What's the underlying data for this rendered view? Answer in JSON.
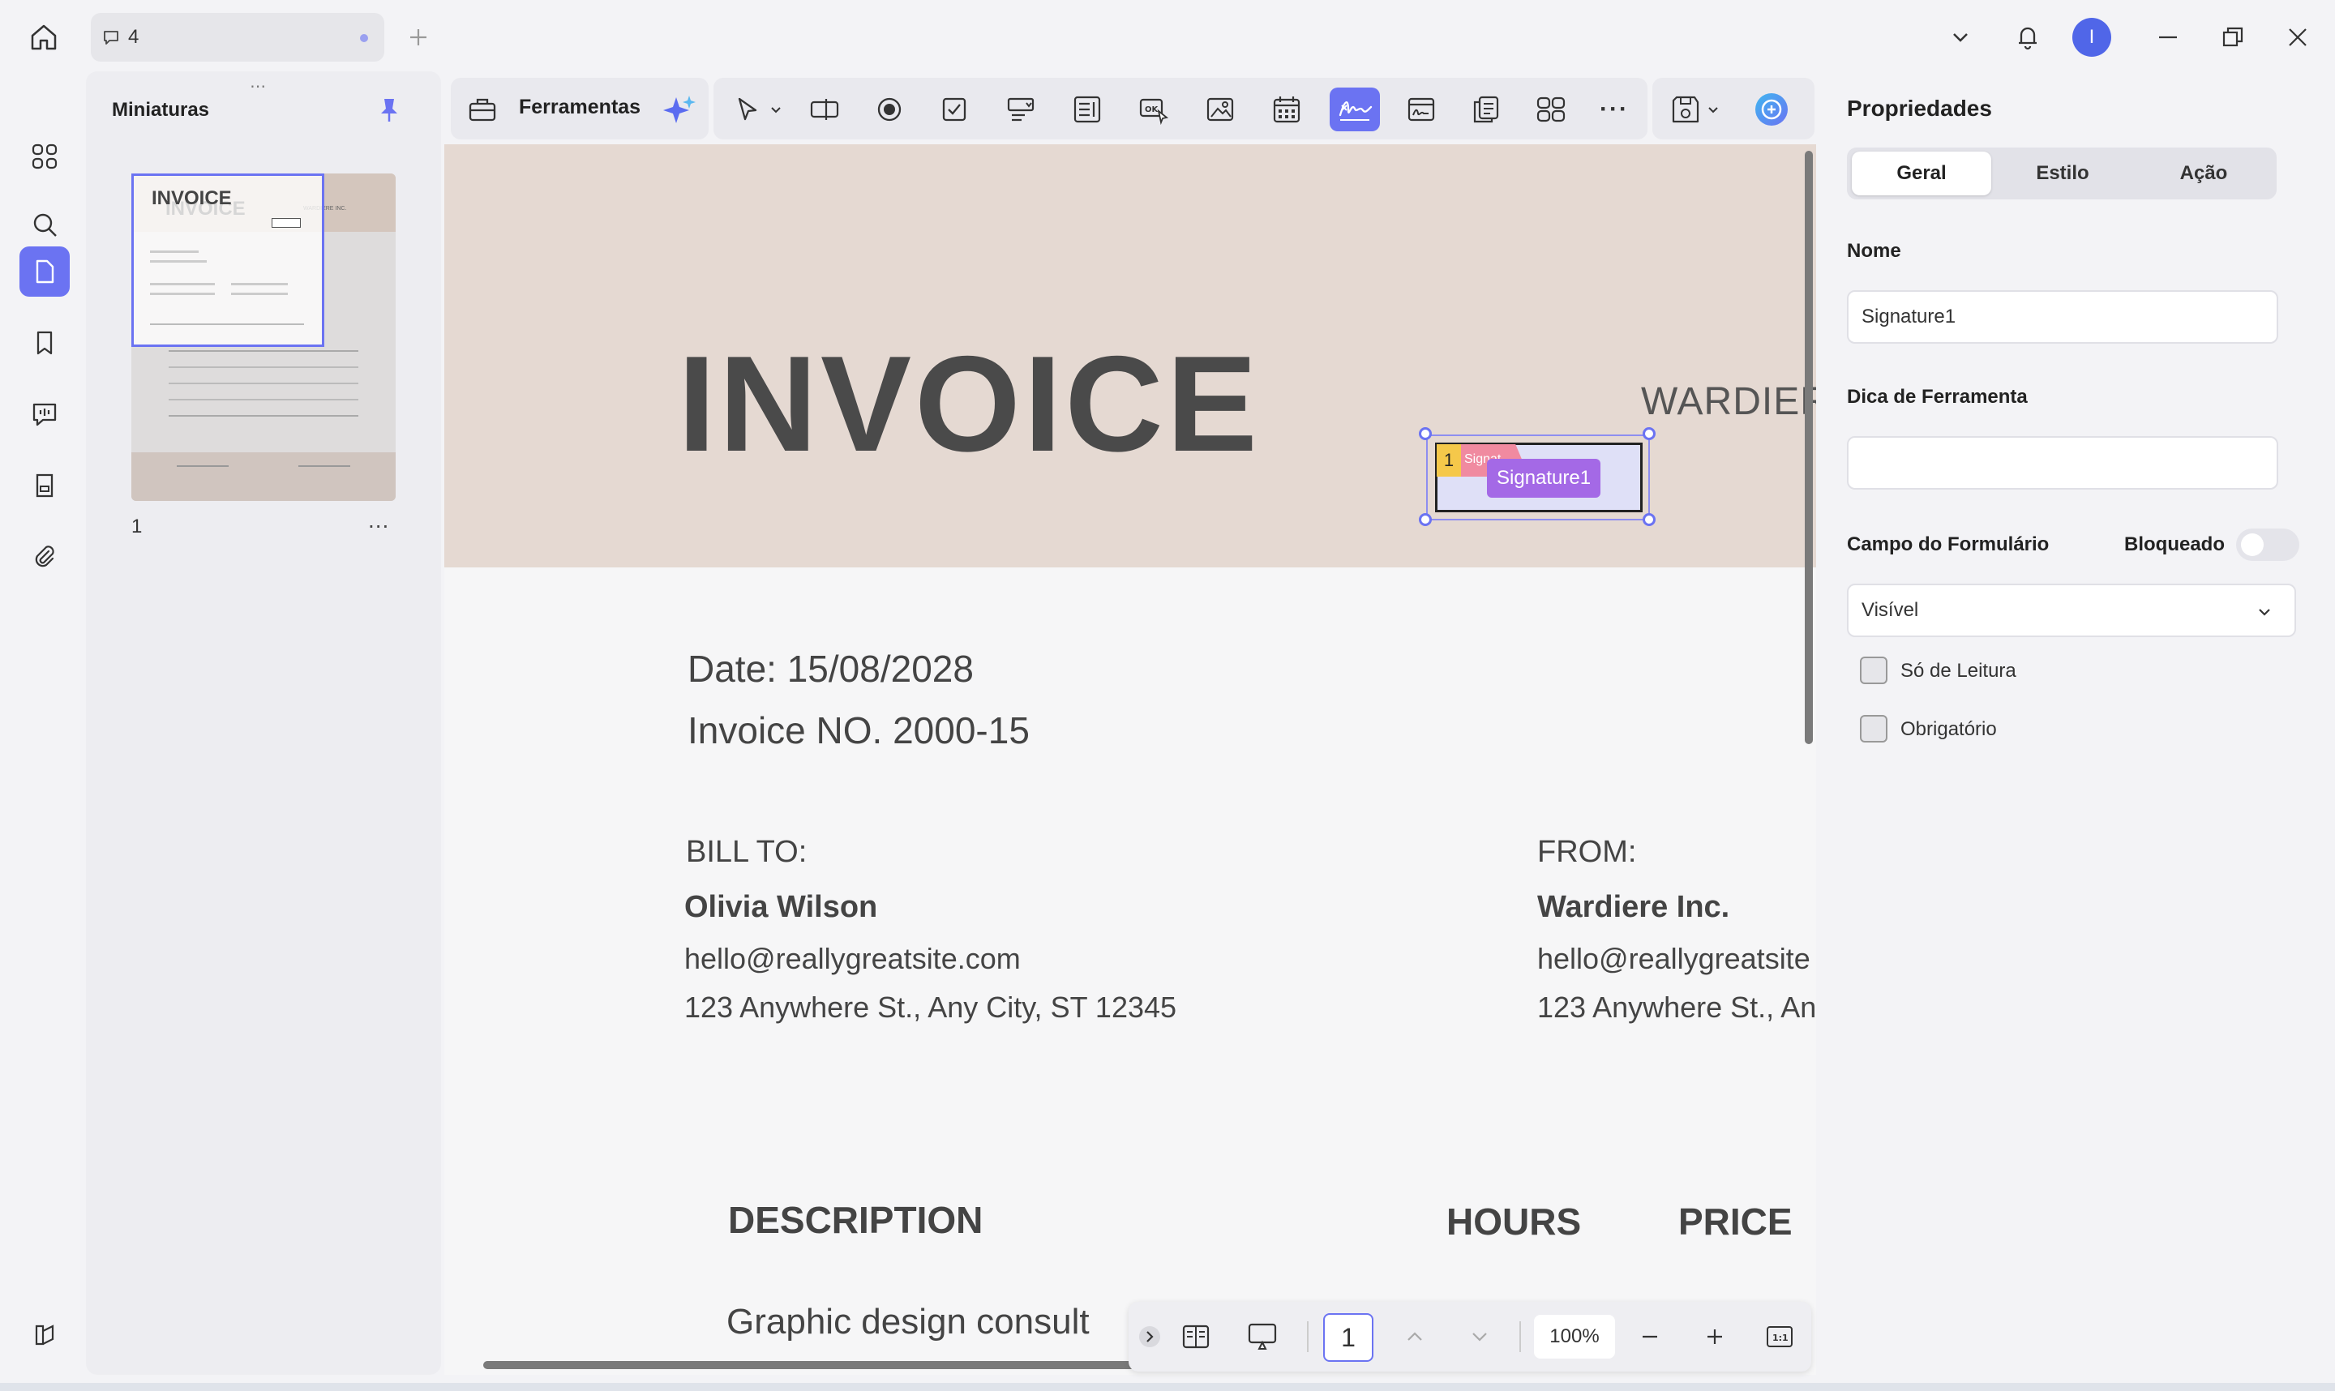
{
  "titlebar": {
    "tab_count": "4",
    "avatar_initial": "I"
  },
  "thumbnails": {
    "title": "Miniaturas",
    "page_number": "1",
    "more": "...",
    "preview": {
      "title": "INVOICE",
      "company": "WARDIERE INC."
    }
  },
  "toolbar": {
    "tools_label": "Ferramentas",
    "more": "···"
  },
  "document": {
    "title": "INVOICE",
    "company_heading": "WARDIER",
    "date": "Date: 15/08/2028",
    "invoice_no": "Invoice NO. 2000-15",
    "bill_to": {
      "label": "BILL TO:",
      "name": "Olivia  Wilson",
      "email": "hello@reallygreatsite.com",
      "address": "123 Anywhere St., Any City, ST 12345"
    },
    "from": {
      "label": "FROM:",
      "name": "Wardiere Inc.",
      "email": "hello@reallygreatsite",
      "address": "123 Anywhere St., An"
    },
    "table": {
      "headers": [
        "DESCRIPTION",
        "HOURS",
        "PRICE"
      ],
      "first_row": "Graphic design consult"
    },
    "signature_field": {
      "order": "1",
      "flag_text": "Signat",
      "label": "Signature1"
    }
  },
  "pagebar": {
    "page": "1",
    "zoom": "100%"
  },
  "properties": {
    "title": "Propriedades",
    "tabs": [
      "Geral",
      "Estilo",
      "Ação"
    ],
    "name_label": "Nome",
    "name_value": "Signature1",
    "tooltip_label": "Dica de Ferramenta",
    "tooltip_value": "",
    "form_field_label": "Campo do Formulário",
    "locked_label": "Bloqueado",
    "visibility_value": "Visível",
    "readonly_label": "Só de Leitura",
    "required_label": "Obrigatório"
  },
  "colors": {
    "accent": "#6b73f2",
    "signature_label": "#a469e6",
    "header_band": "#e5d9d2"
  }
}
